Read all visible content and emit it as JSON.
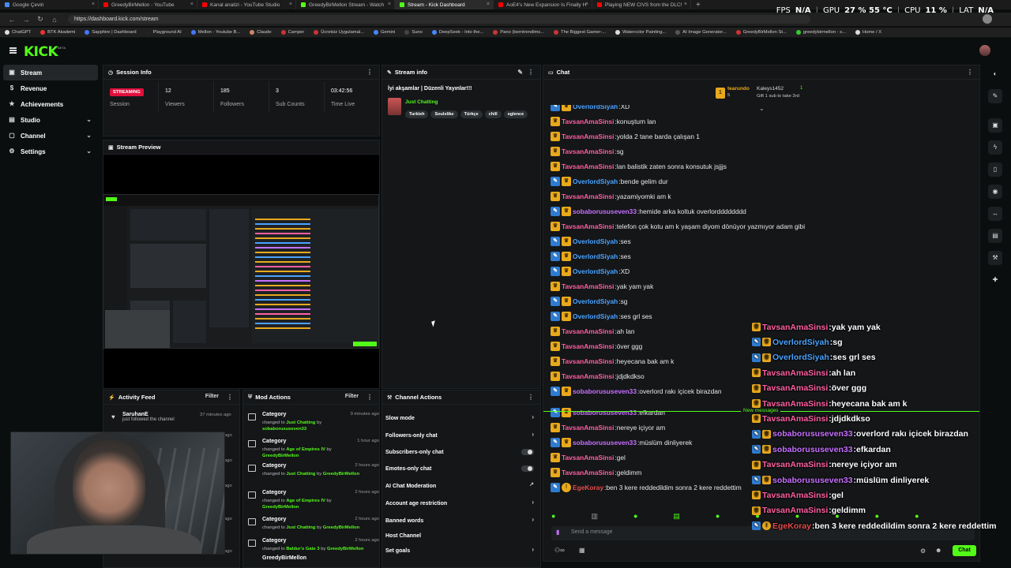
{
  "browser": {
    "tabs": [
      {
        "title": "Google Çeviri",
        "color": "#4a8af4",
        "active": false
      },
      {
        "title": "GreedyBirMellon - YouTube",
        "color": "#ff0000",
        "active": false
      },
      {
        "title": "Kanal analizi - YouTube Studio",
        "color": "#ff0000",
        "active": false
      },
      {
        "title": "GreedyBirMellon Stream - Watch",
        "color": "#53fc18",
        "active": false
      },
      {
        "title": "Stream - Kick Dashboard",
        "color": "#53fc18",
        "active": true
      },
      {
        "title": "AoE4's New Expansion Is Finally H",
        "color": "#ff0000",
        "active": false
      },
      {
        "title": "Playing NEW CIVS from the DLC!",
        "color": "#ff0000",
        "active": false
      }
    ],
    "url": "https://dashboard.kick.com/stream",
    "hud": {
      "fps_label": "FPS",
      "fps": "N/A",
      "gpu_label": "GPU",
      "gpu": "27 % 55 °C",
      "cpu_label": "CPU",
      "cpu": "11 %",
      "lat_label": "LAT",
      "lat": "N/A"
    },
    "bookmarks": [
      {
        "label": "ChatGPT",
        "color": "#ddd"
      },
      {
        "label": "BTK Akademi",
        "color": "#e33"
      },
      {
        "label": "Sapphire | Dashboard",
        "color": "#47f"
      },
      {
        "label": "Playground AI",
        "color": "#222"
      },
      {
        "label": "Mellon - Youtube B...",
        "color": "#47f"
      },
      {
        "label": "Claude",
        "color": "#c86"
      },
      {
        "label": "Camper",
        "color": "#c33"
      },
      {
        "label": "Ücretsiz Uygulamal...",
        "color": "#c33"
      },
      {
        "label": "Gemini",
        "color": "#48f"
      },
      {
        "label": "Suno",
        "color": "#444"
      },
      {
        "label": "DeepSeek - Into the...",
        "color": "#48f"
      },
      {
        "label": "Pano (berntrendims...",
        "color": "#c33"
      },
      {
        "label": "The Biggest Gamer-...",
        "color": "#c33"
      },
      {
        "label": "Watercolor Painting...",
        "color": "#ddd"
      },
      {
        "label": "AI Image Generator...",
        "color": "#555"
      },
      {
        "label": "GreedyBirMellon St...",
        "color": "#c33"
      },
      {
        "label": "greedybirmellon - s...",
        "color": "#3c3"
      },
      {
        "label": "Home / X",
        "color": "#ddd"
      }
    ]
  },
  "header": {
    "logo": "KICK",
    "beta": "BETA"
  },
  "sidebar": {
    "items": [
      {
        "label": "Stream",
        "icon": "▣",
        "icon_name": "stream-icon",
        "expandable": false,
        "active": true
      },
      {
        "label": "Revenue",
        "icon": "$",
        "icon_name": "revenue-icon",
        "expandable": false,
        "active": false
      },
      {
        "label": "Achievements",
        "icon": "★",
        "icon_name": "achievements-icon",
        "expandable": false,
        "active": false
      },
      {
        "label": "Studio",
        "icon": "▤",
        "icon_name": "studio-icon",
        "expandable": true,
        "active": false
      },
      {
        "label": "Channel",
        "icon": "▢",
        "icon_name": "channel-icon",
        "expandable": true,
        "active": false
      },
      {
        "label": "Settings",
        "icon": "⚙",
        "icon_name": "settings-icon",
        "expandable": true,
        "active": false
      }
    ]
  },
  "session_info": {
    "title": "Session Info",
    "status": "STREAMING",
    "stats": [
      {
        "label": "Session",
        "value": ""
      },
      {
        "label": "Viewers",
        "value": "12"
      },
      {
        "label": "Followers",
        "value": "185"
      },
      {
        "label": "Sub Counts",
        "value": "3"
      },
      {
        "label": "Time Live",
        "value": "03:42:56"
      }
    ]
  },
  "stream_info": {
    "title": "Stream info",
    "stream_title": "İyi akşamlar | Düzenli Yayınlar!!!",
    "category": "Just Chatting",
    "tags": [
      "Turkish",
      "Soulslike",
      "Türkçe",
      "chill",
      "eglence"
    ]
  },
  "stream_preview": {
    "title": "Stream Preview"
  },
  "activity_feed": {
    "title": "Activity Feed",
    "filter": "Filter",
    "items": [
      {
        "user": "SaruhanE",
        "action": "just followed the channel",
        "time": "37 minutes ago"
      }
    ],
    "partial_time": "ago"
  },
  "mod_actions": {
    "title": "Mod Actions",
    "filter": "Filter",
    "items": [
      {
        "title": "Category",
        "prefix": "changed to",
        "value": "Just Chatting",
        "by_prefix": "by",
        "by": "sobaborususeven33",
        "time": "9 minutes ago"
      },
      {
        "title": "Category",
        "prefix": "changed to",
        "value": "Age of Empires IV",
        "by_prefix": "by",
        "by": "GreedyBirMellon",
        "time": "1 hour ago"
      },
      {
        "title": "Category",
        "prefix": "changed to",
        "value": "Just Chatting",
        "by_prefix": "by",
        "by": "GreedyBirMellon",
        "time": "2 hours ago"
      },
      {
        "title": "Category",
        "prefix": "changed to",
        "value": "Age of Empires IV",
        "by_prefix": "by",
        "by": "GreedyBirMellon",
        "time": "2 hours ago"
      },
      {
        "title": "Category",
        "prefix": "changed to",
        "value": "Just Chatting",
        "by_prefix": "by",
        "by": "GreedyBirMellon",
        "time": "2 hours ago"
      },
      {
        "title": "Category",
        "prefix": "changed to",
        "value": "Baldur's Gate 3",
        "by_prefix": "by",
        "by": "GreedyBirMellon",
        "time": "2 hours ago"
      },
      {
        "title": "GreedyBirMellon",
        "prefix": "",
        "value": "",
        "by_prefix": "",
        "by": "",
        "time": ""
      }
    ]
  },
  "channel_actions": {
    "title": "Channel Actions",
    "items": [
      {
        "label": "Slow mode",
        "control": "arrow"
      },
      {
        "label": "Followers-only chat",
        "control": "arrow"
      },
      {
        "label": "Subscribers-only chat",
        "control": "toggle"
      },
      {
        "label": "Emotes-only chat",
        "control": "toggle"
      },
      {
        "label": "AI Chat Moderation",
        "control": "external"
      },
      {
        "label": "Account age restriction",
        "control": "arrow"
      },
      {
        "label": "Banned words",
        "control": "arrow"
      },
      {
        "label": "Host Channel",
        "control": "none"
      },
      {
        "label": "Set goals",
        "control": "arrow"
      }
    ]
  },
  "chat": {
    "title": "Chat",
    "pinned": {
      "top_user": "tearundo",
      "top_count": "5",
      "second_user": "Kaleys1452",
      "second_count": "1",
      "gift_text": "Gift 1 sub to take 3rd"
    },
    "messages": [
      {
        "user": "OverlordSiyah",
        "color": "#4aa3ff",
        "badges": [
          "pen",
          "crown"
        ],
        "text": "XD"
      },
      {
        "user": "TavsanAmaSinsi",
        "color": "#ff5fa2",
        "badges": [
          "crown"
        ],
        "text": "konuştum lan"
      },
      {
        "user": "TavsanAmaSinsi",
        "color": "#ff5fa2",
        "badges": [
          "crown"
        ],
        "text": "yolda 2 tane barda çalışan 1"
      },
      {
        "user": "TavsanAmaSinsi",
        "color": "#ff5fa2",
        "badges": [
          "crown"
        ],
        "text": "sg"
      },
      {
        "user": "TavsanAmaSinsi",
        "color": "#ff5fa2",
        "badges": [
          "crown"
        ],
        "text": "lan balistik zaten sonra konsutuk jsjjjs"
      },
      {
        "user": "OverlordSiyah",
        "color": "#4aa3ff",
        "badges": [
          "pen",
          "crown"
        ],
        "text": "bende gelim dur"
      },
      {
        "user": "TavsanAmaSinsi",
        "color": "#ff5fa2",
        "badges": [
          "crown"
        ],
        "text": "yazamiyomki am k"
      },
      {
        "user": "sobaborususeven33",
        "color": "#c770ff",
        "badges": [
          "pen",
          "crown"
        ],
        "text": "hemide arka koltuk overlordddddddd"
      },
      {
        "user": "TavsanAmaSinsi",
        "color": "#ff5fa2",
        "badges": [
          "crown"
        ],
        "text": "telefon çok kotu am k yaşam diyom dönüyor yazmıyor adam gibi"
      },
      {
        "user": "OverlordSiyah",
        "color": "#4aa3ff",
        "badges": [
          "pen",
          "crown"
        ],
        "text": "ses"
      },
      {
        "user": "OverlordSiyah",
        "color": "#4aa3ff",
        "badges": [
          "pen",
          "crown"
        ],
        "text": "ses"
      },
      {
        "user": "OverlordSiyah",
        "color": "#4aa3ff",
        "badges": [
          "pen",
          "crown"
        ],
        "text": "XD"
      },
      {
        "user": "TavsanAmaSinsi",
        "color": "#ff5fa2",
        "badges": [
          "crown"
        ],
        "text": "yak yam yak"
      },
      {
        "user": "OverlordSiyah",
        "color": "#4aa3ff",
        "badges": [
          "pen",
          "crown"
        ],
        "text": "sg"
      },
      {
        "user": "OverlordSiyah",
        "color": "#4aa3ff",
        "badges": [
          "pen",
          "crown"
        ],
        "text": "ses grl ses"
      },
      {
        "user": "TavsanAmaSinsi",
        "color": "#ff5fa2",
        "badges": [
          "crown"
        ],
        "text": "ah lan"
      },
      {
        "user": "TavsanAmaSinsi",
        "color": "#ff5fa2",
        "badges": [
          "crown"
        ],
        "text": "över ggg"
      },
      {
        "user": "TavsanAmaSinsi",
        "color": "#ff5fa2",
        "badges": [
          "crown"
        ],
        "text": "heyecana bak am k"
      },
      {
        "user": "TavsanAmaSinsi",
        "color": "#ff5fa2",
        "badges": [
          "crown"
        ],
        "text": "jdjdkdkso"
      },
      {
        "user": "sobaborususeven33",
        "color": "#c770ff",
        "badges": [
          "pen",
          "crown"
        ],
        "text": "overlord rakı içicek birazdan"
      },
      {
        "user": "sobaborususeven33",
        "color": "#c770ff",
        "badges": [
          "pen",
          "crown"
        ],
        "text": "efkardan"
      },
      {
        "user": "TavsanAmaSinsi",
        "color": "#ff5fa2",
        "badges": [
          "crown"
        ],
        "text": "nereye içiyor am"
      },
      {
        "user": "sobaborususeven33",
        "color": "#c770ff",
        "badges": [
          "pen",
          "crown"
        ],
        "text": "müslüm dinliyerek"
      },
      {
        "user": "TavsanAmaSinsi",
        "color": "#ff5fa2",
        "badges": [
          "crown"
        ],
        "text": "gel"
      },
      {
        "user": "TavsanAmaSinsi",
        "color": "#ff5fa2",
        "badges": [
          "crown"
        ],
        "text": "geldimm"
      },
      {
        "user": "EgeKoray",
        "color": "#e34a4a",
        "badges": [
          "pen",
          "gift"
        ],
        "text": "ben 3 kere reddedildim sonra 2 kere reddettim"
      }
    ],
    "new_messages": "New messages",
    "input_placeholder": "Send a message",
    "send": "Chat"
  },
  "overlay_chat": {
    "messages": [
      {
        "user": "TavsanAmaSinsi",
        "color": "#ff5fa2",
        "badges": [
          "crown"
        ],
        "text": "yak yam yak"
      },
      {
        "user": "OverlordSiyah",
        "color": "#4aa3ff",
        "badges": [
          "pen",
          "crown"
        ],
        "text": "sg"
      },
      {
        "user": "OverlordSiyah",
        "color": "#4aa3ff",
        "badges": [
          "pen",
          "crown"
        ],
        "text": "ses grl ses"
      },
      {
        "user": "TavsanAmaSinsi",
        "color": "#ff5fa2",
        "badges": [
          "crown"
        ],
        "text": "ah lan"
      },
      {
        "user": "TavsanAmaSinsi",
        "color": "#ff5fa2",
        "badges": [
          "crown"
        ],
        "text": "över ggg"
      },
      {
        "user": "TavsanAmaSinsi",
        "color": "#ff5fa2",
        "badges": [
          "crown"
        ],
        "text": "heyecana bak am k"
      },
      {
        "user": "TavsanAmaSinsi",
        "color": "#ff5fa2",
        "badges": [
          "crown"
        ],
        "text": "jdjdkdkso"
      },
      {
        "user": "sobaborususeven33",
        "color": "#c770ff",
        "badges": [
          "pen",
          "crown"
        ],
        "text": "overlord rakı içicek birazdan"
      },
      {
        "user": "sobaborususeven33",
        "color": "#c770ff",
        "badges": [
          "pen",
          "crown"
        ],
        "text": "efkardan"
      },
      {
        "user": "TavsanAmaSinsi",
        "color": "#ff5fa2",
        "badges": [
          "crown"
        ],
        "text": "nereye içiyor am"
      },
      {
        "user": "sobaborususeven33",
        "color": "#c770ff",
        "badges": [
          "pen",
          "crown"
        ],
        "text": "müslüm dinliyerek"
      },
      {
        "user": "TavsanAmaSinsi",
        "color": "#ff5fa2",
        "badges": [
          "crown"
        ],
        "text": "gel"
      },
      {
        "user": "TavsanAmaSinsi",
        "color": "#ff5fa2",
        "badges": [
          "crown"
        ],
        "text": "geldimm"
      },
      {
        "user": "EgeKoray",
        "color": "#e34a4a",
        "badges": [
          "pen",
          "gift"
        ],
        "text": "ben 3 kere reddedildim sonra 2 kere reddettim"
      }
    ]
  },
  "right_rail": {
    "icons": [
      "dark-mode-icon",
      "edit-icon",
      "layout-icon",
      "lightning-icon",
      "clipboard-icon",
      "chat-bubble-icon",
      "link-icon",
      "browser-icon",
      "wrench-icon",
      "puzzle-icon"
    ]
  },
  "theme": {
    "accent": "#53fc18",
    "live": "#e0103c"
  }
}
